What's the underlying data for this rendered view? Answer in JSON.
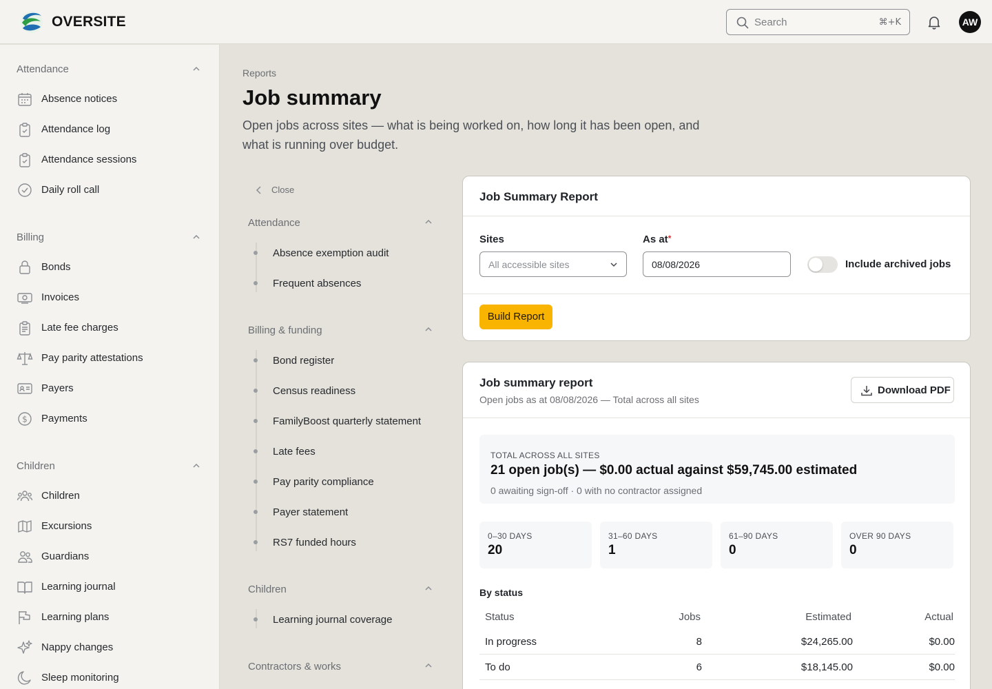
{
  "app": {
    "brand": "OVERSITE",
    "user_initials": "AW"
  },
  "search": {
    "placeholder": "Search",
    "shortcut": "⌘+K"
  },
  "sidebar": {
    "groups": [
      {
        "title": "Attendance",
        "items": [
          {
            "label": "Absence notices",
            "icon": "calendar-icon"
          },
          {
            "label": "Attendance log",
            "icon": "clipboard-check-icon"
          },
          {
            "label": "Attendance sessions",
            "icon": "clipboard-check-icon"
          },
          {
            "label": "Daily roll call",
            "icon": "check-circle-icon"
          }
        ]
      },
      {
        "title": "Billing",
        "items": [
          {
            "label": "Bonds",
            "icon": "lock-icon"
          },
          {
            "label": "Invoices",
            "icon": "banknote-icon"
          },
          {
            "label": "Late fee charges",
            "icon": "receipt-icon"
          },
          {
            "label": "Pay parity attestations",
            "icon": "scale-icon"
          },
          {
            "label": "Payers",
            "icon": "id-card-icon"
          },
          {
            "label": "Payments",
            "icon": "dollar-circle-icon"
          }
        ]
      },
      {
        "title": "Children",
        "items": [
          {
            "label": "Children",
            "icon": "users-icon"
          },
          {
            "label": "Excursions",
            "icon": "map-icon"
          },
          {
            "label": "Guardians",
            "icon": "user-pair-icon"
          },
          {
            "label": "Learning journal",
            "icon": "book-open-icon"
          },
          {
            "label": "Learning plans",
            "icon": "flag-icon"
          },
          {
            "label": "Nappy changes",
            "icon": "sparkles-icon"
          },
          {
            "label": "Sleep monitoring",
            "icon": "moon-icon"
          }
        ]
      }
    ]
  },
  "page": {
    "breadcrumb": "Reports",
    "title": "Job summary",
    "description": "Open jobs across sites — what is being worked on, how long it has been open, and what is running over budget."
  },
  "subnav": {
    "close_label": "Close",
    "groups": [
      {
        "title": "Attendance",
        "items": [
          "Absence exemption audit",
          "Frequent absences"
        ]
      },
      {
        "title": "Billing & funding",
        "items": [
          "Bond register",
          "Census readiness",
          "FamilyBoost quarterly statement",
          "Late fees",
          "Pay parity compliance",
          "Payer statement",
          "RS7 funded hours"
        ]
      },
      {
        "title": "Children",
        "items": [
          "Learning journal coverage"
        ]
      },
      {
        "title": "Contractors & works",
        "items": []
      }
    ]
  },
  "form": {
    "title": "Job Summary Report",
    "sites_label": "Sites",
    "sites_value": "All accessible sites",
    "as_at_label": "As at",
    "as_at_required": "*",
    "as_at_value": "08/08/2026",
    "archived_label": "Include archived jobs",
    "archived_on": false,
    "build_label": "Build Report",
    "accent_color": "#f8b400"
  },
  "report": {
    "title": "Job summary report",
    "subtitle": "Open jobs as at 08/08/2026 — Total across all sites",
    "download_label": "Download PDF",
    "total": {
      "kicker": "TOTAL ACROSS ALL SITES",
      "headline": "21 open job(s) — $0.00 actual against $59,745.00 estimated",
      "detail": "0 awaiting sign-off · 0 with no contractor assigned"
    },
    "ageing": [
      {
        "label": "0–30 DAYS",
        "value": "20"
      },
      {
        "label": "31–60 DAYS",
        "value": "1"
      },
      {
        "label": "61–90 DAYS",
        "value": "0"
      },
      {
        "label": "OVER 90 DAYS",
        "value": "0"
      }
    ],
    "by_status": {
      "title": "By status",
      "columns": [
        "Status",
        "Jobs",
        "Estimated",
        "Actual"
      ],
      "rows": [
        {
          "status": "In progress",
          "jobs": "8",
          "estimated": "$24,265.00",
          "actual": "$0.00"
        },
        {
          "status": "To do",
          "jobs": "6",
          "estimated": "$18,145.00",
          "actual": "$0.00"
        }
      ]
    }
  }
}
